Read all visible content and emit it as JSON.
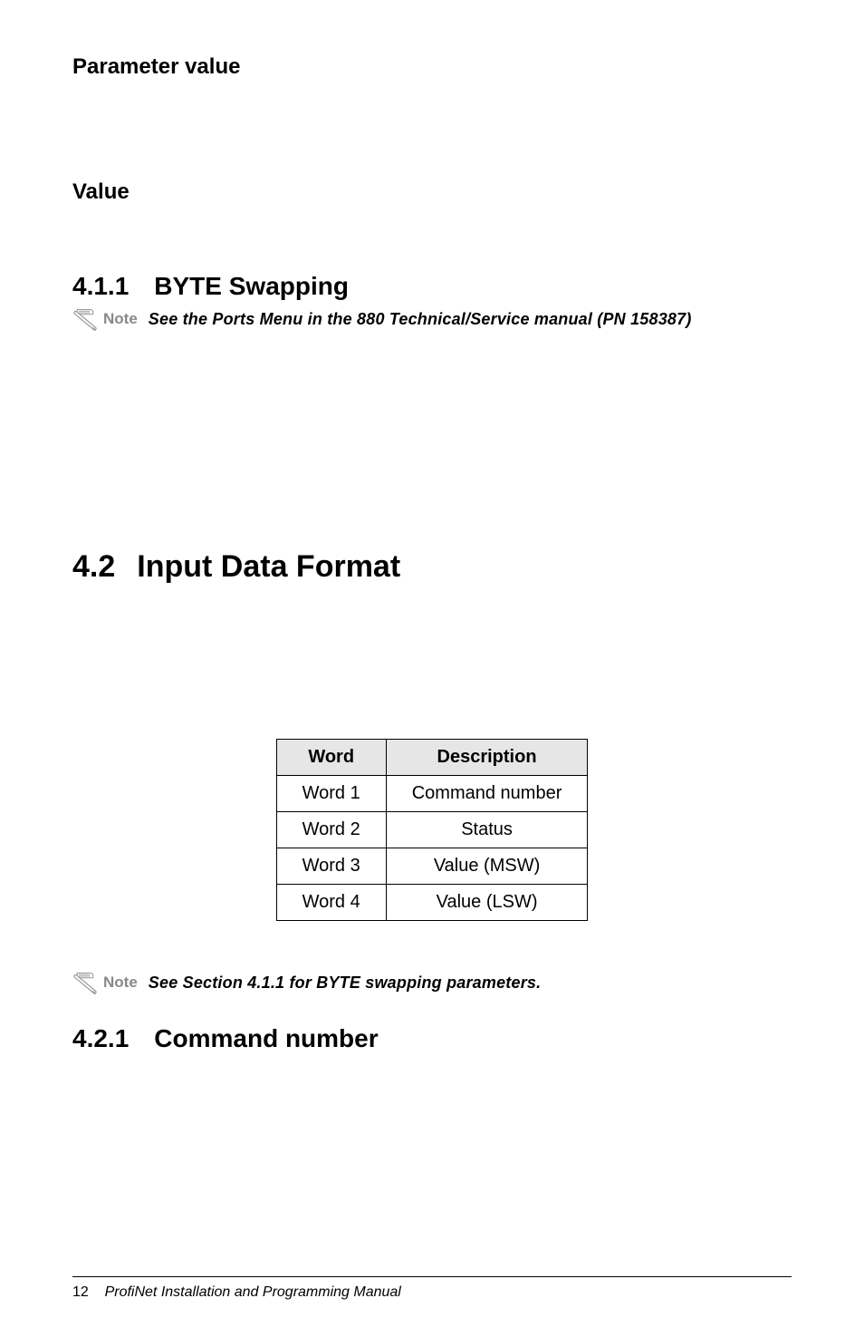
{
  "headings": {
    "parameter_value": "Parameter value",
    "value": "Value",
    "byte_swapping_num": "4.1.1",
    "byte_swapping_title": "BYTE Swapping",
    "input_data_num": "4.2",
    "input_data_title": "Input Data Format",
    "command_number_num": "4.2.1",
    "command_number_title": "Command number"
  },
  "notes": {
    "label": "Note",
    "ports_menu": "See the Ports Menu in the 880 Technical/Service manual (PN 158387)",
    "byte_swap": "See Section 4.1.1 for BYTE swapping parameters."
  },
  "table": {
    "headers": {
      "word": "Word",
      "description": "Description"
    },
    "rows": [
      {
        "word": "Word 1",
        "desc": "Command number"
      },
      {
        "word": "Word 2",
        "desc": "Status"
      },
      {
        "word": "Word 3",
        "desc": "Value (MSW)"
      },
      {
        "word": "Word 4",
        "desc": "Value (LSW)"
      }
    ]
  },
  "footer": {
    "page": "12",
    "title": "ProfiNet Installation and Programming Manual"
  }
}
